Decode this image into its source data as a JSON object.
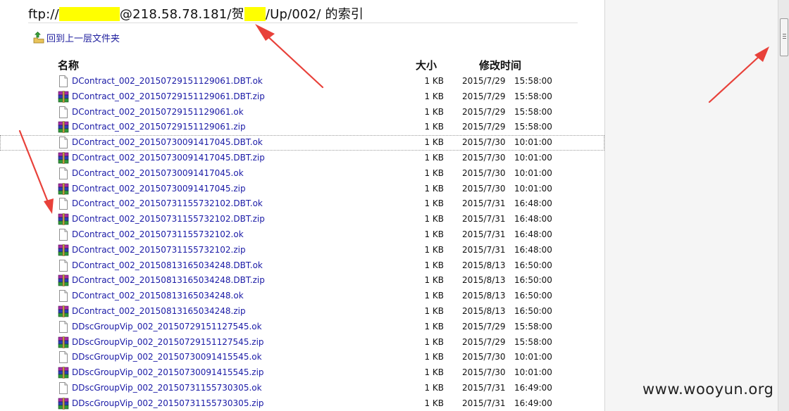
{
  "heading": {
    "prefix": "ftp://",
    "host_path": "@218.58.78.181/贺",
    "suffix": "/Up/002/ 的索引"
  },
  "parent_link": {
    "label": "回到上一层文件夹",
    "icon": "up-folder-icon"
  },
  "columns": {
    "name": "名称",
    "size": "大小",
    "modified": "修改时间"
  },
  "files": [
    {
      "name": "DContract_002_20150729151129061.DBT.ok",
      "type": "file",
      "size": "1 KB",
      "date": "2015/7/29",
      "time": "15:58:00"
    },
    {
      "name": "DContract_002_20150729151129061.DBT.zip",
      "type": "zip",
      "size": "1 KB",
      "date": "2015/7/29",
      "time": "15:58:00"
    },
    {
      "name": "DContract_002_20150729151129061.ok",
      "type": "file",
      "size": "1 KB",
      "date": "2015/7/29",
      "time": "15:58:00"
    },
    {
      "name": "DContract_002_20150729151129061.zip",
      "type": "zip",
      "size": "1 KB",
      "date": "2015/7/29",
      "time": "15:58:00"
    },
    {
      "name": "DContract_002_20150730091417045.DBT.ok",
      "type": "file",
      "size": "1 KB",
      "date": "2015/7/30",
      "time": "10:01:00",
      "selected": true
    },
    {
      "name": "DContract_002_20150730091417045.DBT.zip",
      "type": "zip",
      "size": "1 KB",
      "date": "2015/7/30",
      "time": "10:01:00"
    },
    {
      "name": "DContract_002_20150730091417045.ok",
      "type": "file",
      "size": "1 KB",
      "date": "2015/7/30",
      "time": "10:01:00"
    },
    {
      "name": "DContract_002_20150730091417045.zip",
      "type": "zip",
      "size": "1 KB",
      "date": "2015/7/30",
      "time": "10:01:00"
    },
    {
      "name": "DContract_002_20150731155732102.DBT.ok",
      "type": "file",
      "size": "1 KB",
      "date": "2015/7/31",
      "time": "16:48:00"
    },
    {
      "name": "DContract_002_20150731155732102.DBT.zip",
      "type": "zip",
      "size": "1 KB",
      "date": "2015/7/31",
      "time": "16:48:00"
    },
    {
      "name": "DContract_002_20150731155732102.ok",
      "type": "file",
      "size": "1 KB",
      "date": "2015/7/31",
      "time": "16:48:00"
    },
    {
      "name": "DContract_002_20150731155732102.zip",
      "type": "zip",
      "size": "1 KB",
      "date": "2015/7/31",
      "time": "16:48:00"
    },
    {
      "name": "DContract_002_20150813165034248.DBT.ok",
      "type": "file",
      "size": "1 KB",
      "date": "2015/8/13",
      "time": "16:50:00"
    },
    {
      "name": "DContract_002_20150813165034248.DBT.zip",
      "type": "zip",
      "size": "1 KB",
      "date": "2015/8/13",
      "time": "16:50:00"
    },
    {
      "name": "DContract_002_20150813165034248.ok",
      "type": "file",
      "size": "1 KB",
      "date": "2015/8/13",
      "time": "16:50:00"
    },
    {
      "name": "DContract_002_20150813165034248.zip",
      "type": "zip",
      "size": "1 KB",
      "date": "2015/8/13",
      "time": "16:50:00"
    },
    {
      "name": "DDscGroupVip_002_20150729151127545.ok",
      "type": "file",
      "size": "1 KB",
      "date": "2015/7/29",
      "time": "15:58:00"
    },
    {
      "name": "DDscGroupVip_002_20150729151127545.zip",
      "type": "zip",
      "size": "1 KB",
      "date": "2015/7/29",
      "time": "15:58:00"
    },
    {
      "name": "DDscGroupVip_002_20150730091415545.ok",
      "type": "file",
      "size": "1 KB",
      "date": "2015/7/30",
      "time": "10:01:00"
    },
    {
      "name": "DDscGroupVip_002_20150730091415545.zip",
      "type": "zip",
      "size": "1 KB",
      "date": "2015/7/30",
      "time": "10:01:00"
    },
    {
      "name": "DDscGroupVip_002_20150731155730305.ok",
      "type": "file",
      "size": "1 KB",
      "date": "2015/7/31",
      "time": "16:49:00"
    },
    {
      "name": "DDscGroupVip_002_20150731155730305.zip",
      "type": "zip",
      "size": "1 KB",
      "date": "2015/7/31",
      "time": "16:49:00"
    }
  ],
  "watermark": "www.wooyun.org",
  "colors": {
    "link": "#1a1aa6",
    "redaction": "#ffff00",
    "annotation_arrow": "#e8413a",
    "selection_border": "#9c9c9c"
  }
}
